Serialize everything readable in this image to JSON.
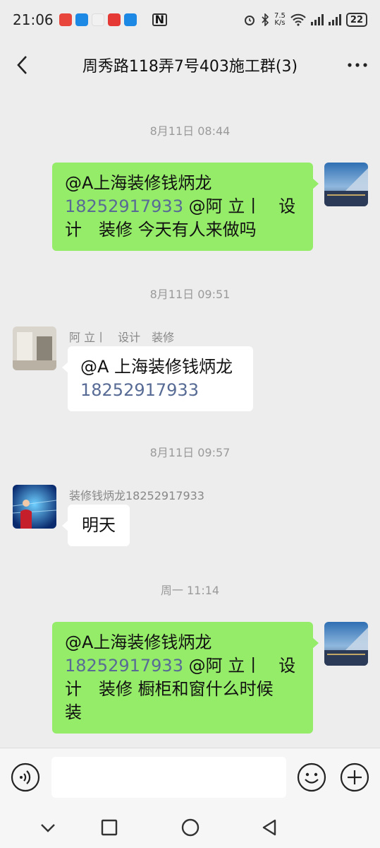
{
  "status_bar": {
    "time": "21:06",
    "network_speed_value": "7.5",
    "network_speed_unit": "K/s",
    "battery": "22",
    "app_icon_colors": [
      "#e8453c",
      "#1e88e5",
      "#e84a4a",
      "#e53935",
      "#1e88e5"
    ]
  },
  "header": {
    "title": "周秀路118弄7号403施工群(3)",
    "back_icon": "chevron-left-icon",
    "more_icon": "more-horizontal-icon"
  },
  "messages": [
    {
      "timestamp": "8月11日 08:44",
      "side": "me",
      "mention": "@A上海装修钱炳龙",
      "phone": "18252917933",
      "rest_line1": " @阿 立丨　设",
      "rest_line2": "计　装修 今天有人来做吗"
    },
    {
      "timestamp": "8月11日 09:51",
      "side": "other",
      "sender": "阿 立丨　设计　装修",
      "mention": "@A 上海装修钱炳龙",
      "phone": "18252917933"
    },
    {
      "timestamp": "8月11日 09:57",
      "side": "other",
      "sender": "装修钱炳龙18252917933",
      "text": "明天"
    },
    {
      "timestamp": "周一 11:14",
      "side": "me",
      "mention": "@A上海装修钱炳龙",
      "phone": "18252917933",
      "rest_line1": " @阿 立丨　设",
      "rest_line2": "计　装修 橱柜和窗什么时候",
      "rest_line3": "装"
    }
  ],
  "input_bar": {
    "voice_icon": "voice-icon",
    "emoji_icon": "emoji-icon",
    "add_icon": "plus-circle-icon"
  },
  "nav_bar": {
    "icons": [
      "chevron-down-icon",
      "square-recent-icon",
      "circle-home-icon",
      "triangle-back-icon"
    ]
  },
  "colors": {
    "background": "#ededed",
    "my_bubble": "#95ec69",
    "other_bubble": "#ffffff",
    "phone_link": "#576b95"
  }
}
